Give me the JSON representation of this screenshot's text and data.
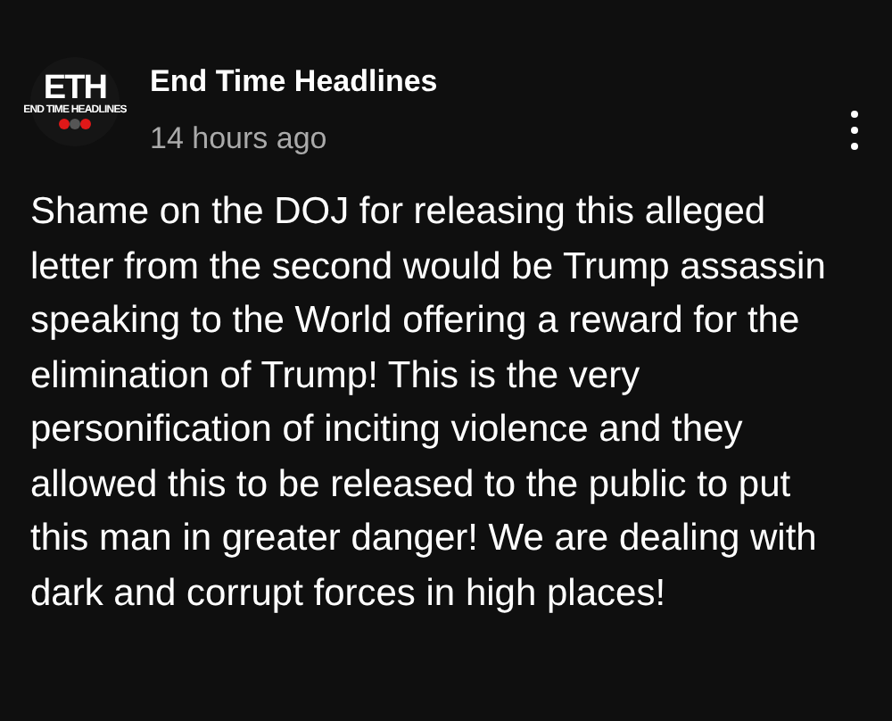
{
  "post": {
    "avatar": {
      "logo_text": "ETH",
      "logo_subtext": "END TIME HEADLINES"
    },
    "author": "End Time Headlines",
    "time": "14 hours ago",
    "body": "Shame on the DOJ for releasing this alleged letter from the second would be Trump assassin  speaking to the World offering a reward for the elimination of Trump! This is the very personification of inciting violence and they allowed this to be released to the public to put this man in greater danger! We are dealing with dark and corrupt forces in high places!"
  }
}
